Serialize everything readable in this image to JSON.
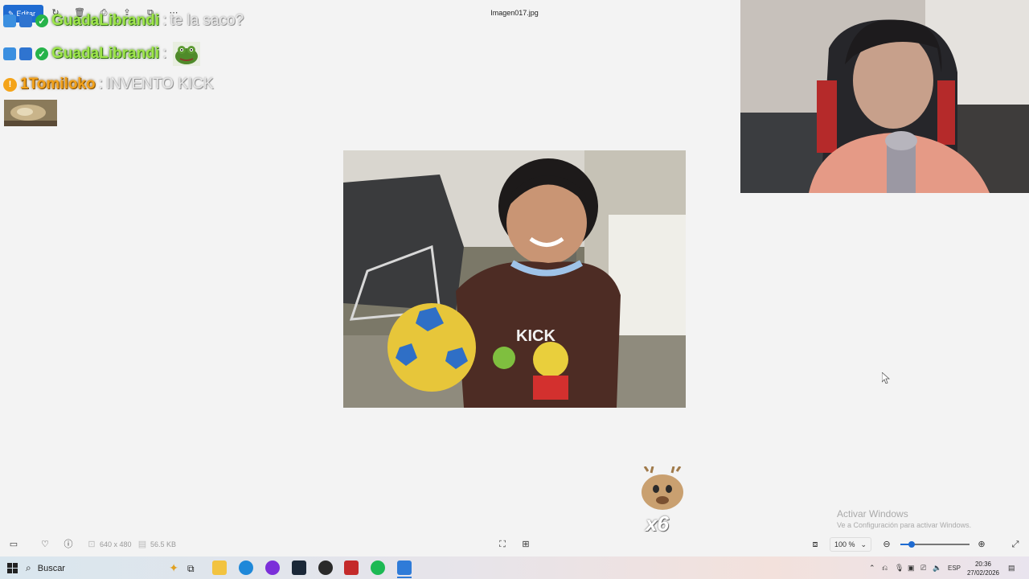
{
  "toolbar": {
    "edit_label": "Editar",
    "file_title": "Imagen017.jpg",
    "icons": [
      "rotate-icon",
      "delete-icon",
      "print-icon",
      "share-icon",
      "copy-icon",
      "more-icon"
    ]
  },
  "chat": {
    "messages": [
      {
        "user": "GuadaLibrandi",
        "sep": ":",
        "text": "te la saco?"
      },
      {
        "user": "GuadaLibrandi",
        "sep": ":",
        "text": ""
      },
      {
        "user": "1Tomiloko",
        "sep": ":",
        "text": "INVENTO KICK"
      }
    ]
  },
  "photo": {
    "shirt_text": "KICK"
  },
  "overlay": {
    "multiplier": "x6"
  },
  "statusbar": {
    "dimensions": "640 x 480",
    "filesize": "56.5 KB",
    "zoom": "100 %"
  },
  "watermark": {
    "line1": "Activar Windows",
    "line2": "Ve a Configuración para activar Windows."
  },
  "taskbar": {
    "search_placeholder": "Buscar",
    "language": "ESP",
    "time": "20:36",
    "date": "27/02/2026"
  },
  "colors": {
    "accent": "#1f6bd1",
    "chat_name_green": "#9ee64a",
    "chat_name_orange": "#f3a21b"
  }
}
